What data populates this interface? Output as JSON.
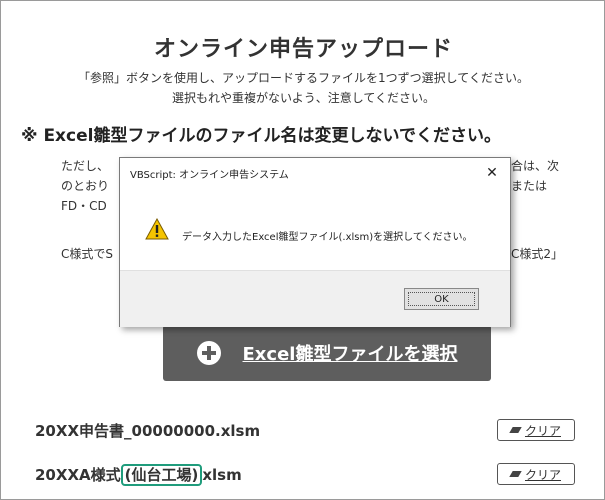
{
  "page": {
    "title": "オンライン申告アップロード",
    "instruction_line1": "「参照」ボタンを使用し、アップロードするファイルを1つずつ選択してください。",
    "instruction_line2": "選択もれや重複がないよう、注意してください。",
    "warning": "※ Excel雛型ファイルのファイル名は変更しないでください。",
    "body_line1": "ただし、",
    "body_line2": "のとおり",
    "body_line3": "FD・CD",
    "body_line4": "C様式でS",
    "right_line1": "合は、次",
    "right_line2": "または",
    "right_line4": "C様式2」",
    "select_button": "Excel雛型ファイルを選択",
    "files": [
      {
        "name_pre": "20XX申告書_00000000.xlsm",
        "name_hl": "",
        "name_post": "",
        "clear_label": "クリア"
      },
      {
        "name_pre": "20XXA様式",
        "name_hl": "(仙台工場)",
        "name_post": "xlsm",
        "clear_label": "クリア"
      }
    ]
  },
  "dialog": {
    "title": "VBScript: オンライン申告システム",
    "close_glyph": "✕",
    "message": "データ入力したExcel雛型ファイル(.xlsm)を選択してください。",
    "ok_label": "OK",
    "icon": "warning-icon"
  },
  "colors": {
    "highlight": "#1f9c7c",
    "select_button_bg": "#5e5e5e"
  }
}
